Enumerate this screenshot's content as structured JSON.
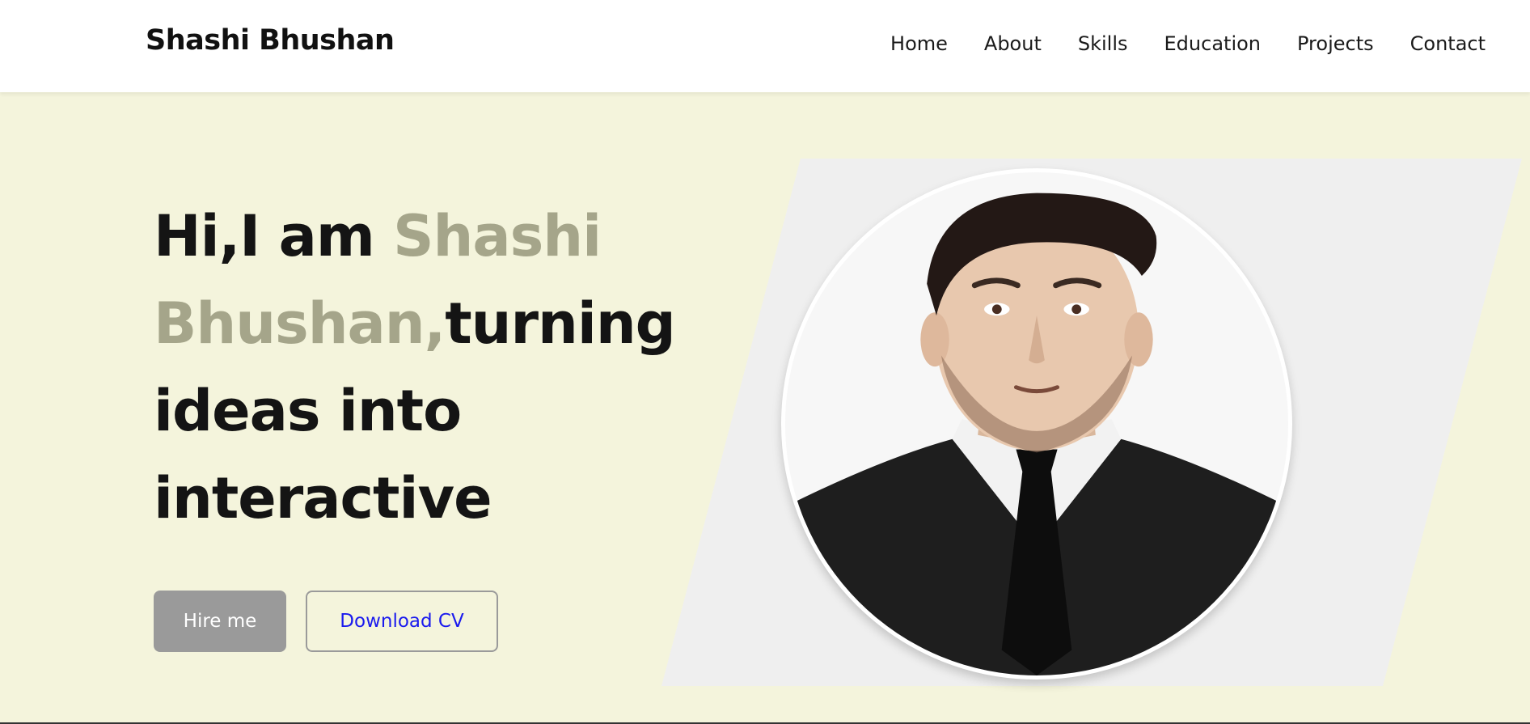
{
  "header": {
    "brand": "Shashi Bhushan",
    "nav": [
      "Home",
      "About",
      "Skills",
      "Education",
      "Projects",
      "Contact"
    ]
  },
  "hero": {
    "line1_prefix": "Hi,I am ",
    "line1_accent": "Shashi",
    "line2_accent": "Bhushan,",
    "line2_rest": "turning",
    "line3": "ideas into",
    "line4": "interactive",
    "hire_button": "Hire me",
    "cv_button": "Download CV"
  },
  "colors": {
    "hero_bg": "#f4f4dc",
    "accent_text": "#a5a58a",
    "hire_bg": "#9a9a9a",
    "cv_text": "#1a1aee",
    "panel": "#efefef"
  },
  "icons": {
    "profile": "profile-photo"
  }
}
